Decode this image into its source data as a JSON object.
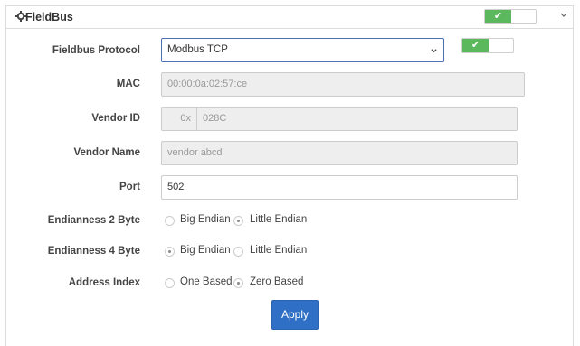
{
  "header": {
    "title": "FieldBus",
    "gear_icon": "gear-icon",
    "toggle_on": "✔",
    "collapse_icon": "chevron-down-icon"
  },
  "form": {
    "protocol": {
      "label": "Fieldbus Protocol",
      "value": "Modbus TCP",
      "toggle_on": "✔"
    },
    "mac": {
      "label": "MAC",
      "value": "00:00:0a:02:57:ce"
    },
    "vendor_id": {
      "label": "Vendor ID",
      "prefix": "0x",
      "value": "028C"
    },
    "vendor_name": {
      "label": "Vendor Name",
      "value": "vendor abcd"
    },
    "port": {
      "label": "Port",
      "value": "502"
    },
    "endian2": {
      "label": "Endianness 2 Byte",
      "options": [
        "Big Endian",
        "Little Endian"
      ],
      "selected": "Little Endian"
    },
    "endian4": {
      "label": "Endianness 4 Byte",
      "options": [
        "Big Endian",
        "Little Endian"
      ],
      "selected": "Big Endian"
    },
    "address_index": {
      "label": "Address Index",
      "options": [
        "One Based",
        "Zero Based"
      ],
      "selected": "Zero Based"
    }
  },
  "apply_label": "Apply",
  "colors": {
    "accent": "#2f6fc6",
    "toggle_on": "#5cb85c"
  }
}
